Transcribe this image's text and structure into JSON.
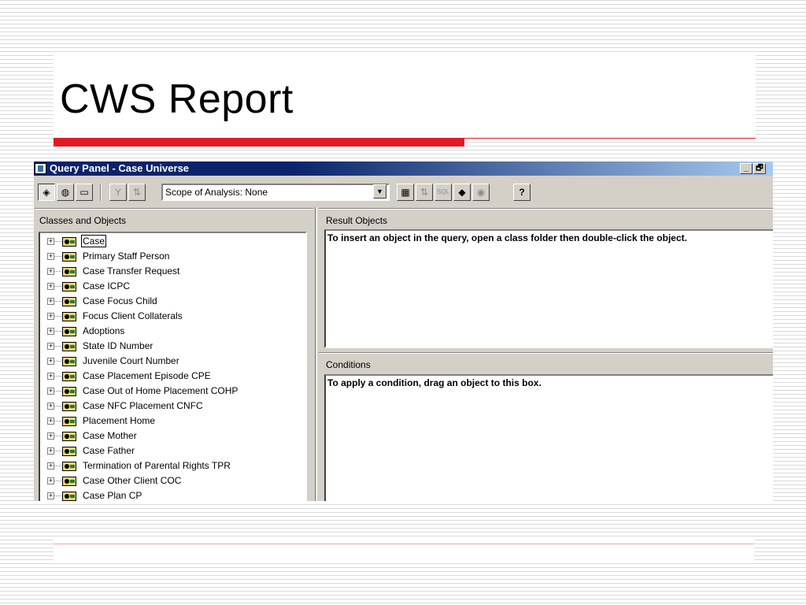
{
  "slide": {
    "title": "CWS Report"
  },
  "window": {
    "title": "Query Panel - Case Universe",
    "minimize_label": "_",
    "restore_label": "🗗"
  },
  "toolbar": {
    "buttons": [
      {
        "icon": "query-panel-icon",
        "glyph": "◈"
      },
      {
        "icon": "classes-objects-icon",
        "glyph": "◍"
      },
      {
        "icon": "predefined-conditions-icon",
        "glyph": "▭"
      },
      {
        "icon": "filter-icon",
        "glyph": "Y"
      },
      {
        "icon": "sort-icon",
        "glyph": "⇅"
      },
      {
        "icon": "view-data-icon",
        "glyph": "▦"
      },
      {
        "icon": "sort-results-icon",
        "glyph": "⇅"
      },
      {
        "icon": "sql-icon",
        "glyph": "SQL"
      },
      {
        "icon": "combined-query-icon",
        "glyph": "◆"
      },
      {
        "icon": "operand-icon",
        "glyph": "◉"
      },
      {
        "icon": "help-icon",
        "glyph": "?"
      }
    ],
    "scope_of_analysis": "Scope of Analysis: None"
  },
  "classes_pane": {
    "label": "Classes and Objects",
    "items": [
      {
        "label": "Case"
      },
      {
        "label": "Primary Staff Person"
      },
      {
        "label": "Case Transfer Request"
      },
      {
        "label": "Case ICPC"
      },
      {
        "label": "Case Focus Child"
      },
      {
        "label": "Focus Client Collaterals"
      },
      {
        "label": "Adoptions"
      },
      {
        "label": "State ID Number"
      },
      {
        "label": "Juvenile Court Number"
      },
      {
        "label": "Case Placement Episode CPE"
      },
      {
        "label": "Case Out of Home Placement COHP"
      },
      {
        "label": "Case NFC Placement CNFC"
      },
      {
        "label": "Placement Home"
      },
      {
        "label": "Case Mother"
      },
      {
        "label": "Case Father"
      },
      {
        "label": "Termination of Parental Rights TPR"
      },
      {
        "label": "Case Other Client COC"
      },
      {
        "label": "Case Plan CP"
      }
    ]
  },
  "result_objects": {
    "label": "Result Objects",
    "hint": "To insert an object in the query, open a class folder then double-click the object."
  },
  "conditions": {
    "label": "Conditions",
    "hint": "To apply a condition, drag an object to this box."
  }
}
